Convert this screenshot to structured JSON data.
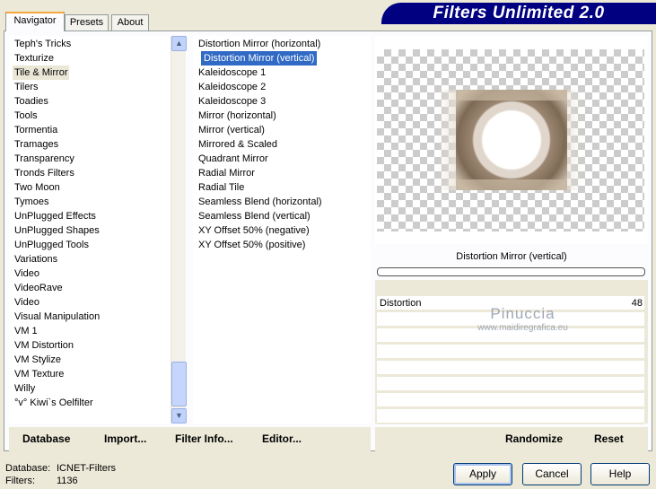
{
  "app_title": "Filters Unlimited 2.0",
  "tabs": [
    {
      "label": "Navigator",
      "active": true
    },
    {
      "label": "Presets"
    },
    {
      "label": "About"
    }
  ],
  "categories": [
    "Teph's Tricks",
    "Texturize",
    "Tile & Mirror",
    "Tilers",
    "Toadies",
    "Tools",
    "Tormentia",
    "Tramages",
    "Transparency",
    "Tronds Filters",
    "Two Moon",
    "Tymoes",
    "UnPlugged Effects",
    "UnPlugged Shapes",
    "UnPlugged Tools",
    "Variations",
    "Video",
    "VideoRave",
    "Video",
    "Visual Manipulation",
    "VM 1",
    "VM Distortion",
    "VM Stylize",
    "VM Texture",
    "Willy",
    "°v° Kiwi`s Oelfilter"
  ],
  "selected_category": "Tile & Mirror",
  "filters": [
    "Distortion Mirror (horizontal)",
    "Distortion Mirror (vertical)",
    "Kaleidoscope 1",
    "Kaleidoscope 2",
    "Kaleidoscope 3",
    "Mirror (horizontal)",
    "Mirror (vertical)",
    "Mirrored & Scaled",
    "Quadrant Mirror",
    "Radial Mirror",
    "Radial Tile",
    "Seamless Blend (horizontal)",
    "Seamless Blend (vertical)",
    "XY Offset 50% (negative)",
    "XY Offset 50% (positive)"
  ],
  "selected_filter": "Distortion Mirror (vertical)",
  "preview": {
    "filter_name": "Distortion Mirror (vertical)",
    "progress": 0
  },
  "params": [
    {
      "label": "Distortion",
      "value": "48"
    }
  ],
  "watermark": {
    "name": "Pinuccia",
    "url": "www.maidiregrafica.eu"
  },
  "bottom_left": {
    "database": "Database",
    "import": "Import...",
    "filter_info": "Filter Info...",
    "editor": "Editor..."
  },
  "bottom_right": {
    "randomize": "Randomize",
    "reset": "Reset"
  },
  "status": {
    "database_label": "Database:",
    "database_value": "ICNET-Filters",
    "filters_label": "Filters:",
    "filters_value": "1136"
  },
  "buttons": {
    "apply": "Apply",
    "cancel": "Cancel",
    "help": "Help"
  },
  "colors": {
    "selection": "#316ac5",
    "banner": "#000080"
  }
}
